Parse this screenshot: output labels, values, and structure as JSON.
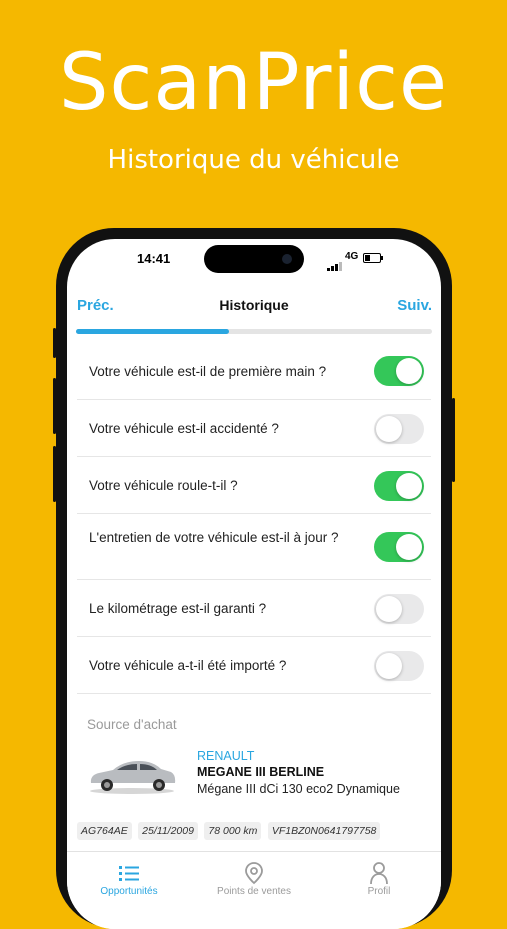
{
  "hero": {
    "title": "ScanPrice",
    "subtitle": "Historique du véhicule"
  },
  "status_bar": {
    "time": "14:41",
    "network": "4G"
  },
  "nav": {
    "prev": "Préc.",
    "title": "Historique",
    "next": "Suiv."
  },
  "progress": {
    "value": 0.43
  },
  "questions": [
    {
      "text": "Votre véhicule est-il de première main ?",
      "on": true
    },
    {
      "text": "Votre véhicule est-il accidenté ?",
      "on": false
    },
    {
      "text": "Votre véhicule roule-t-il ?",
      "on": true
    },
    {
      "text": "L'entretien de votre véhicule est-il à jour ?",
      "on": true
    },
    {
      "text": "Le kilométrage est-il garanti ?",
      "on": false
    },
    {
      "text": "Votre véhicule a-t-il été importé ?",
      "on": false
    }
  ],
  "source": {
    "header": "Source d'achat"
  },
  "vehicle": {
    "brand": "RENAULT",
    "model": "MEGANE III BERLINE",
    "version": "Mégane III dCi 130 eco2 Dynamique",
    "plate": "AG764AE",
    "date": "25/11/2009",
    "mileage": "78 000 km",
    "vin": "VF1BZ0N0641797758"
  },
  "tabs": [
    {
      "label": "Opportunités",
      "icon": "list-icon",
      "active": true
    },
    {
      "label": "Points de ventes",
      "icon": "map-pin-icon",
      "active": false
    },
    {
      "label": "Profil",
      "icon": "person-icon",
      "active": false
    }
  ],
  "colors": {
    "background": "#f5b800",
    "accent": "#2aa6e0",
    "toggle_on": "#34c759",
    "toggle_off": "#e9e9ea"
  }
}
